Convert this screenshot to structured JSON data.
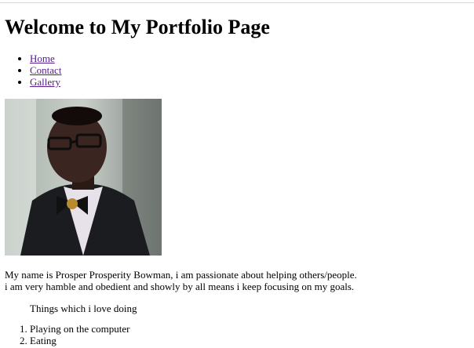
{
  "page": {
    "title": "Welcome to My Portfolio Page"
  },
  "nav": {
    "items": [
      {
        "label": "Home"
      },
      {
        "label": "Contact"
      },
      {
        "label": "Gallery"
      }
    ]
  },
  "profile_photo": {
    "description_icon": "portrait-photo"
  },
  "bio": {
    "line1": "My name is Prosper Prosperity Bowman, i am passionate about helping others/people.",
    "line2": "i am very hamble and obedient and showly by all means i keep focusing on my goals."
  },
  "loves": {
    "heading": "Things which i love doing",
    "items": [
      {
        "label": "Playing on the computer"
      },
      {
        "label": "Eating"
      }
    ]
  }
}
